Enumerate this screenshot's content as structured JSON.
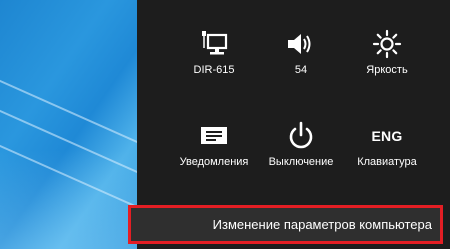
{
  "settings_pane": {
    "network": {
      "label": "DIR-615",
      "icon": "network-monitor-icon"
    },
    "volume": {
      "label": "54",
      "icon": "speaker-icon"
    },
    "brightness": {
      "label": "Яркость",
      "icon": "sun-icon"
    },
    "notifications": {
      "label": "Уведомления",
      "icon": "notification-icon"
    },
    "power": {
      "label": "Выключение",
      "icon": "power-icon"
    },
    "keyboard": {
      "label": "Клавиатура",
      "icon_text": "ENG"
    },
    "change_pc_settings": {
      "label": "Изменение параметров компьютера"
    }
  },
  "colors": {
    "pane_background": "#1d1d1d",
    "highlight_border": "#e31e24",
    "desktop_blue": "#1e86d1"
  }
}
